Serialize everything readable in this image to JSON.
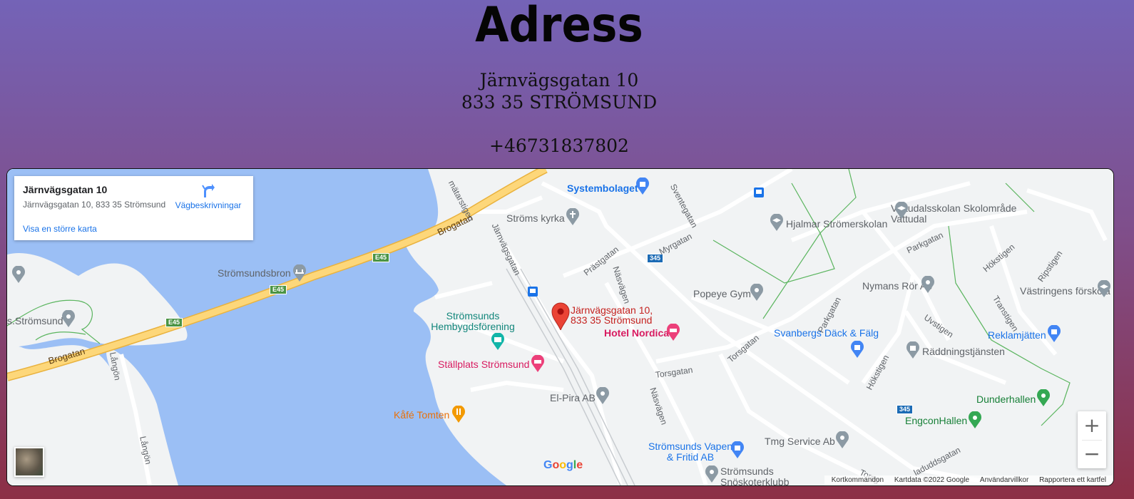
{
  "header": {
    "title": "Adress",
    "street": "Järnvägsgatan 10",
    "postal": "833 35 STRÖMSUND",
    "phone": "+46731837802"
  },
  "map": {
    "infobox": {
      "title": "Järnvägsgatan 10",
      "address": "Järnvägsgatan 10, 833 35 Strömsund",
      "directions": "Vägbeskrivningar",
      "larger_map": "Visa en större karta"
    },
    "pin_label": [
      "Järnvägsgatan 10,",
      "833 35 Strömsund"
    ],
    "pois": {
      "systembolaget": "Systembolaget",
      "stroms_kyrka": "Ströms kyrka",
      "vattudalsskolan": "Vattudalsskolan Skolområde Vattudal",
      "hjalmar": "Hjalmar Strömerskolan",
      "stromsundsbron": "Strömsundsbron",
      "popeye": "Popeye Gym",
      "nymans": "Nymans Rör Ab",
      "vastringens": "Västringens förskola",
      "hembygd": "Strömsunds Hembygdsförening",
      "hotel": "Hotel Nordica",
      "svanbergs": "Svanbergs Däck & Fälg",
      "reklam": "Reklamjätten",
      "raddning": "Räddningstjänsten",
      "stallplats": "Ställplats Strömsund",
      "kafe": "Kåfé Tomten",
      "elpira": "El-Pira AB",
      "dunderhallen": "Dunderhallen",
      "engcon": "EngconHallen",
      "tmg": "Tmg Service Ab",
      "vapen": "Strömsunds Vapen & Fritid AB",
      "snoskoter": "Strömsunds Snöskoterklubb",
      "stromsund": "s.Strömsund"
    },
    "streets": {
      "brogatan": "Brogatan",
      "jarnvagsgatan": "Järnvägsgatan",
      "prastgatan": "Prästgatan",
      "nasvagen": "Näsvägen",
      "myrgatan": "Myrgatan",
      "sventegatan": "Sventegatan",
      "parkgatan": "Parkgatan",
      "hokstigen": "Hökstigen",
      "ripstigen": "Ripstigen",
      "transtigen": "Transtigen",
      "uvstigen": "Uvstigen",
      "torsgatan": "Torsgatan",
      "langon": "Långön",
      "matarstigen": "mätarstigen",
      "laduddsgatan": "laduddsgatan",
      "torsg": "Torsg"
    },
    "badges": {
      "e45": "E45",
      "r345": "345"
    },
    "footer": {
      "shortcuts": "Kortkommandon",
      "mapdata": "Kartdata ©2022 Google",
      "terms": "Användarvillkor",
      "report": "Rapportera ett kartfel"
    },
    "google_logo": "Google",
    "colors": {
      "water": "#9bbff5",
      "land": "#f1f3f4",
      "highway": "#fdd77a",
      "pin": "#ea4335"
    }
  }
}
